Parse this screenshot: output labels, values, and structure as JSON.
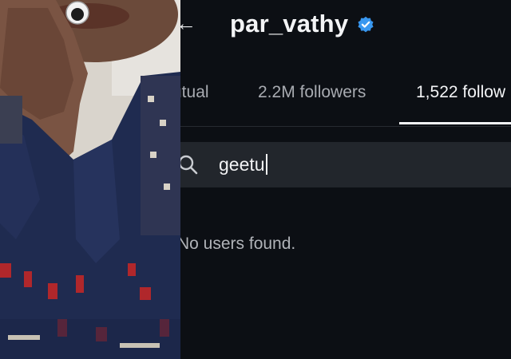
{
  "profile": {
    "username": "par_vathy",
    "verified_icon": "verified-badge-icon",
    "back_icon": "back-arrow-icon"
  },
  "tabs": {
    "mutual_label": "utual",
    "followers_label": "2.2M followers",
    "following_label": "1,522 follow",
    "active": "following"
  },
  "search": {
    "value": "geetu",
    "icon": "search-icon"
  },
  "results": {
    "empty_message": "No users found."
  },
  "colors": {
    "background": "#0c0f14",
    "search_bg": "#22262c",
    "verified_blue": "#3897f0",
    "text_primary": "#f3f4f6",
    "text_secondary": "#a8abb1"
  }
}
